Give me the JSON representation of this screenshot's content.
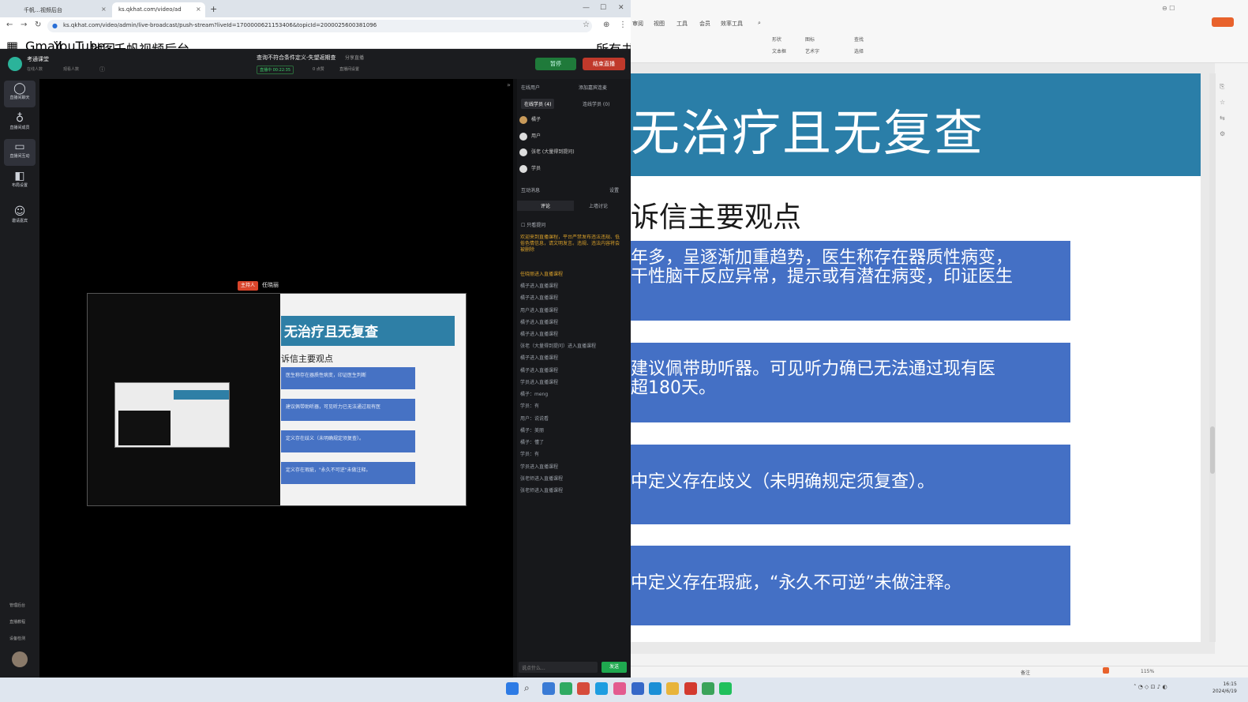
{
  "browser": {
    "tabs": [
      {
        "label": "千帆…视频后台"
      },
      {
        "label": "ks.qkhat.com/video/ad"
      }
    ],
    "new_tab": "+",
    "url": "ks.qkhat.com/video/admin/live-broadcast/push-stream?liveId=1700000621153406&topicId=2000025600381096",
    "bookmarks": [
      "Gmail",
      "YouTube",
      "地图",
      "千帆视频后台"
    ],
    "bookmark_right": "所有书签"
  },
  "app": {
    "header": {
      "brand": "考通课堂",
      "meta1": "在线人数",
      "meta2": "观看人数",
      "live_title": "查询不符合条件定义-失望返期查",
      "live_title_tag": "分享直播",
      "status": "直播中 00:22:35",
      "stat1": "0 点赞",
      "stat2": "直播间设置"
    },
    "buttons": {
      "green": "暂停",
      "red": "结束直播"
    },
    "nav": [
      {
        "label": "直播间聊天",
        "icon": "chat-icon"
      },
      {
        "label": "直播间成员",
        "icon": "mic-icon"
      },
      {
        "label": "直播间互动",
        "icon": "screen-icon"
      },
      {
        "label": "布局设置",
        "icon": "layout-icon"
      },
      {
        "label": "邀请嘉宾",
        "icon": "guest-icon"
      }
    ],
    "nav_bottom": [
      "管理后台",
      "直播教程",
      "设备检测"
    ],
    "right_panel": {
      "online_title": "在线用户",
      "online_right": "添加嘉宾连麦",
      "tab_members": "在线学员 (4)",
      "tab_guests": "连线学员 (0)",
      "members": [
        "橘子",
        "用户",
        "张老 (大量得到提问)",
        "学员"
      ],
      "chat_title": "互动消息",
      "chat_settings": "设置",
      "chat_tab1": "评论",
      "chat_tab2": "上墙讨论",
      "only_host": "只看提问",
      "notice": "欢迎来到直播课程，平台严禁发布违法违规、低俗色情信息，请文明发言。违规、违法内容将会被删除",
      "messages": [
        "任晓丽进入直播课程",
        "橘子进入直播课程",
        "橘子进入直播课程",
        "用户进入直播课程",
        "橘子进入直播课程",
        "橘子进入直播课程",
        "张老（大量得到提问）进入直播课程",
        "橘子进入直播课程",
        "橘子进入直播课程",
        "学员进入直播课程",
        "橘子：meng",
        "学员：有",
        "用户：说说看",
        "橘子：美丽",
        "橘子：懂了",
        "学员：有",
        "学员进入直播课程",
        "张老师进入直播课程",
        "张老师进入直播课程"
      ],
      "input_placeholder": "说点什么...",
      "send": "发送"
    },
    "preview": {
      "host_tag": "主持人",
      "host_name": "任晓丽",
      "title": "无治疗且无复查",
      "sub": "诉信主要观点",
      "boxes": [
        "医生称存在器质性病变，印证医生判断",
        "建议佩带助听器，可见听力已无法通过现有医",
        "定义存在歧义（未明确规定须复查）。",
        "定义存在瑕疵，\"永久不可逆\"未做注释。"
      ]
    }
  },
  "ppt": {
    "menus": [
      "审阅",
      "视图",
      "工具",
      "会员",
      "效率工具"
    ],
    "tools": [
      "形状",
      "图标",
      "文本框",
      "艺术字",
      "查找",
      "选择"
    ],
    "slide": {
      "title": "无治疗且无复查",
      "subtitle": "诉信主要观点",
      "boxes": [
        {
          "lines": [
            "年多，呈逐渐加重趋势，医生称存在器质性病变，",
            "干性脑干反应异常，提示或有潜在病变，印证医生"
          ]
        },
        {
          "lines": [
            "建议佩带助听器。可见听力确已无法通过现有医",
            "超180天。"
          ]
        },
        {
          "lines": [
            "中定义存在歧义（未明确规定须复查）。"
          ]
        },
        {
          "lines": [
            "中定义存在瑕疵，“永久不可逆”未做注释。"
          ]
        }
      ]
    },
    "status_left": "备注",
    "status_zoom": "115%"
  },
  "taskbar": {
    "time": "16:15",
    "date": "2024/6/19"
  },
  "colors": {
    "slide_banner": "#2a7ea8",
    "slide_box": "#4470c5",
    "end_live": "#c0392b",
    "live_green": "#1f7a3a"
  }
}
